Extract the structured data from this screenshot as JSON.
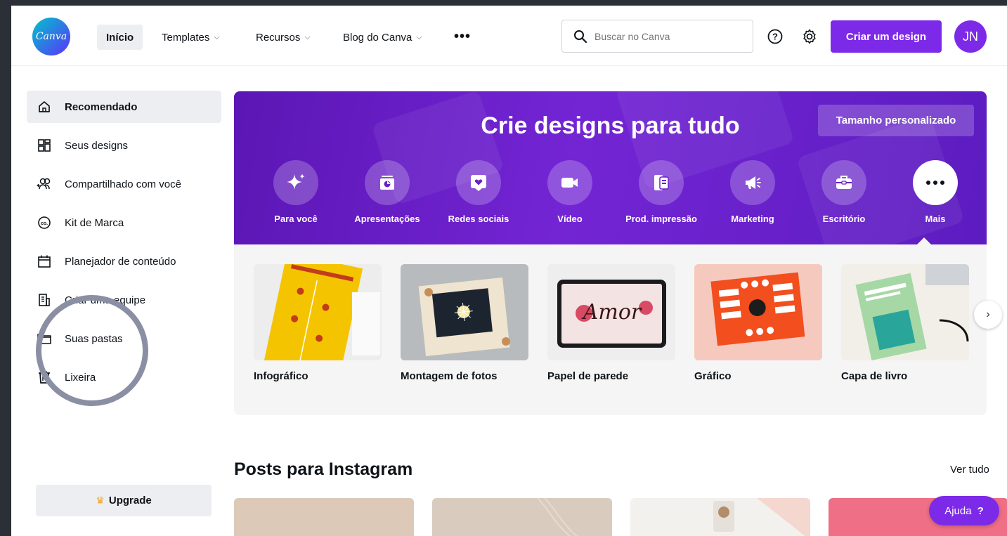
{
  "brand": {
    "logo_text": "Canva",
    "accent": "#7d2ae8"
  },
  "nav": {
    "home": "Início",
    "templates": "Templates",
    "resources": "Recursos",
    "blog": "Blog do Canva",
    "more": "•••",
    "search_placeholder": "Buscar no Canva",
    "create_label": "Criar um design",
    "avatar_initials": "JN"
  },
  "sidebar": {
    "items": [
      {
        "label": "Recomendado",
        "icon": "home-icon"
      },
      {
        "label": "Seus designs",
        "icon": "grid-icon"
      },
      {
        "label": "Compartilhado com você",
        "icon": "shared-users-icon"
      },
      {
        "label": "Kit de Marca",
        "icon": "brand-kit-icon"
      },
      {
        "label": "Planejador de conteúdo",
        "icon": "calendar-icon"
      },
      {
        "label": "Criar uma equipe",
        "icon": "team-icon"
      },
      {
        "label": "Suas pastas",
        "icon": "folder-icon"
      },
      {
        "label": "Lixeira",
        "icon": "trash-icon"
      }
    ],
    "upgrade_label": "Upgrade"
  },
  "hero": {
    "title": "Crie designs para tudo",
    "custom_size_label": "Tamanho personalizado",
    "categories": [
      {
        "label": "Para você",
        "icon": "sparkle-icon"
      },
      {
        "label": "Apresentações",
        "icon": "presentation-icon"
      },
      {
        "label": "Redes sociais",
        "icon": "heart-icon"
      },
      {
        "label": "Vídeo",
        "icon": "video-icon"
      },
      {
        "label": "Prod. impressão",
        "icon": "print-icon"
      },
      {
        "label": "Marketing",
        "icon": "megaphone-icon"
      },
      {
        "label": "Escritório",
        "icon": "briefcase-icon"
      },
      {
        "label": "Mais",
        "icon": "more-icon"
      }
    ]
  },
  "templates": [
    {
      "label": "Infográfico"
    },
    {
      "label": "Montagem de fotos"
    },
    {
      "label": "Papel de parede",
      "thumb_text": "Amor"
    },
    {
      "label": "Gráfico"
    },
    {
      "label": "Capa de livro"
    }
  ],
  "instagram": {
    "title": "Posts para Instagram",
    "see_all": "Ver tudo",
    "post_colors": [
      "#dcc9b8",
      "#d9ccbe",
      "#f3f1ee",
      "#ee6f86"
    ]
  },
  "help_button": {
    "label": "Ajuda",
    "icon": "?"
  }
}
